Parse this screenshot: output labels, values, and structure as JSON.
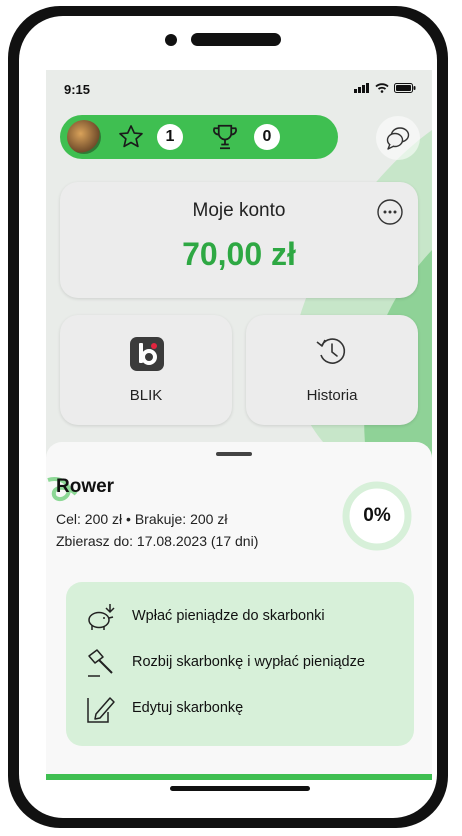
{
  "status_bar": {
    "time": "9:15"
  },
  "header": {
    "stars_count": "1",
    "trophies_count": "0"
  },
  "account": {
    "title": "Moje konto",
    "amount": "70,00 zł"
  },
  "tiles": [
    {
      "label": "BLIK",
      "icon": "blik-icon"
    },
    {
      "label": "Historia",
      "icon": "history-icon"
    }
  ],
  "goal": {
    "name": "Rower",
    "info": "Cel: 200 zł • Brakuje: 200 zł",
    "date": "Zbierasz do: 17.08.2023 (17 dni)",
    "progress_text": "0%",
    "progress_value": 0
  },
  "actions": [
    {
      "label": "Wpłać pieniądze do skarbonki",
      "icon": "piggy-bank-icon"
    },
    {
      "label": "Rozbij skarbonkę i wypłać pieniądze",
      "icon": "hammer-icon"
    },
    {
      "label": "Edytuj skarbonkę",
      "icon": "edit-icon"
    }
  ],
  "colors": {
    "brand_green": "#3fbf51",
    "amount_green": "#2ea843",
    "action_panel": "#d7f0d9"
  }
}
